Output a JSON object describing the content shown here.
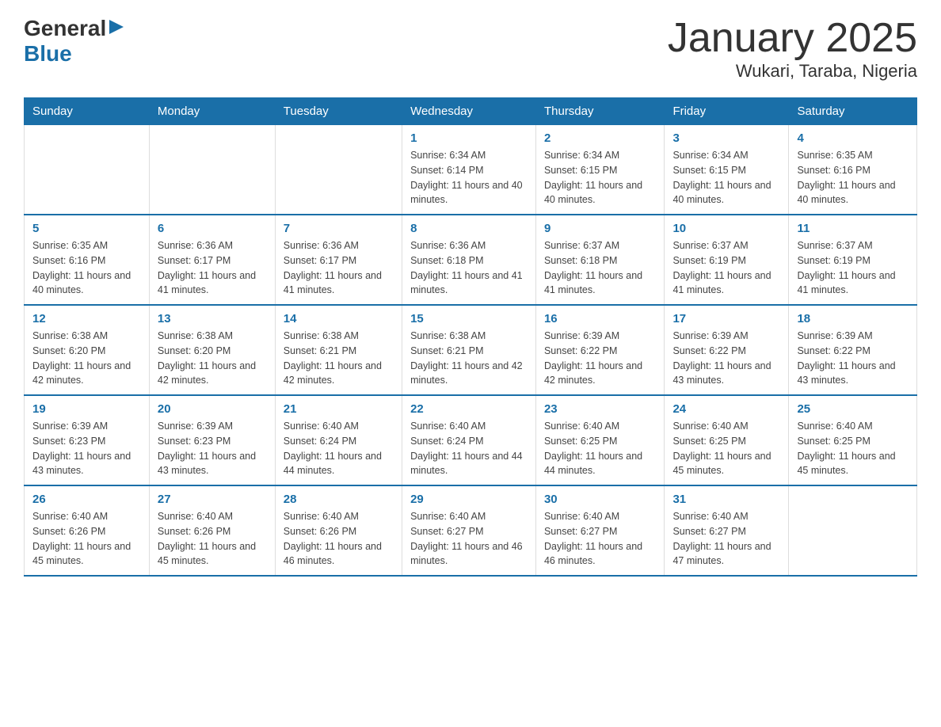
{
  "header": {
    "logo_general": "General",
    "logo_blue": "Blue",
    "month_title": "January 2025",
    "location": "Wukari, Taraba, Nigeria"
  },
  "days_of_week": [
    "Sunday",
    "Monday",
    "Tuesday",
    "Wednesday",
    "Thursday",
    "Friday",
    "Saturday"
  ],
  "weeks": [
    [
      {
        "day": "",
        "info": ""
      },
      {
        "day": "",
        "info": ""
      },
      {
        "day": "",
        "info": ""
      },
      {
        "day": "1",
        "info": "Sunrise: 6:34 AM\nSunset: 6:14 PM\nDaylight: 11 hours and 40 minutes."
      },
      {
        "day": "2",
        "info": "Sunrise: 6:34 AM\nSunset: 6:15 PM\nDaylight: 11 hours and 40 minutes."
      },
      {
        "day": "3",
        "info": "Sunrise: 6:34 AM\nSunset: 6:15 PM\nDaylight: 11 hours and 40 minutes."
      },
      {
        "day": "4",
        "info": "Sunrise: 6:35 AM\nSunset: 6:16 PM\nDaylight: 11 hours and 40 minutes."
      }
    ],
    [
      {
        "day": "5",
        "info": "Sunrise: 6:35 AM\nSunset: 6:16 PM\nDaylight: 11 hours and 40 minutes."
      },
      {
        "day": "6",
        "info": "Sunrise: 6:36 AM\nSunset: 6:17 PM\nDaylight: 11 hours and 41 minutes."
      },
      {
        "day": "7",
        "info": "Sunrise: 6:36 AM\nSunset: 6:17 PM\nDaylight: 11 hours and 41 minutes."
      },
      {
        "day": "8",
        "info": "Sunrise: 6:36 AM\nSunset: 6:18 PM\nDaylight: 11 hours and 41 minutes."
      },
      {
        "day": "9",
        "info": "Sunrise: 6:37 AM\nSunset: 6:18 PM\nDaylight: 11 hours and 41 minutes."
      },
      {
        "day": "10",
        "info": "Sunrise: 6:37 AM\nSunset: 6:19 PM\nDaylight: 11 hours and 41 minutes."
      },
      {
        "day": "11",
        "info": "Sunrise: 6:37 AM\nSunset: 6:19 PM\nDaylight: 11 hours and 41 minutes."
      }
    ],
    [
      {
        "day": "12",
        "info": "Sunrise: 6:38 AM\nSunset: 6:20 PM\nDaylight: 11 hours and 42 minutes."
      },
      {
        "day": "13",
        "info": "Sunrise: 6:38 AM\nSunset: 6:20 PM\nDaylight: 11 hours and 42 minutes."
      },
      {
        "day": "14",
        "info": "Sunrise: 6:38 AM\nSunset: 6:21 PM\nDaylight: 11 hours and 42 minutes."
      },
      {
        "day": "15",
        "info": "Sunrise: 6:38 AM\nSunset: 6:21 PM\nDaylight: 11 hours and 42 minutes."
      },
      {
        "day": "16",
        "info": "Sunrise: 6:39 AM\nSunset: 6:22 PM\nDaylight: 11 hours and 42 minutes."
      },
      {
        "day": "17",
        "info": "Sunrise: 6:39 AM\nSunset: 6:22 PM\nDaylight: 11 hours and 43 minutes."
      },
      {
        "day": "18",
        "info": "Sunrise: 6:39 AM\nSunset: 6:22 PM\nDaylight: 11 hours and 43 minutes."
      }
    ],
    [
      {
        "day": "19",
        "info": "Sunrise: 6:39 AM\nSunset: 6:23 PM\nDaylight: 11 hours and 43 minutes."
      },
      {
        "day": "20",
        "info": "Sunrise: 6:39 AM\nSunset: 6:23 PM\nDaylight: 11 hours and 43 minutes."
      },
      {
        "day": "21",
        "info": "Sunrise: 6:40 AM\nSunset: 6:24 PM\nDaylight: 11 hours and 44 minutes."
      },
      {
        "day": "22",
        "info": "Sunrise: 6:40 AM\nSunset: 6:24 PM\nDaylight: 11 hours and 44 minutes."
      },
      {
        "day": "23",
        "info": "Sunrise: 6:40 AM\nSunset: 6:25 PM\nDaylight: 11 hours and 44 minutes."
      },
      {
        "day": "24",
        "info": "Sunrise: 6:40 AM\nSunset: 6:25 PM\nDaylight: 11 hours and 45 minutes."
      },
      {
        "day": "25",
        "info": "Sunrise: 6:40 AM\nSunset: 6:25 PM\nDaylight: 11 hours and 45 minutes."
      }
    ],
    [
      {
        "day": "26",
        "info": "Sunrise: 6:40 AM\nSunset: 6:26 PM\nDaylight: 11 hours and 45 minutes."
      },
      {
        "day": "27",
        "info": "Sunrise: 6:40 AM\nSunset: 6:26 PM\nDaylight: 11 hours and 45 minutes."
      },
      {
        "day": "28",
        "info": "Sunrise: 6:40 AM\nSunset: 6:26 PM\nDaylight: 11 hours and 46 minutes."
      },
      {
        "day": "29",
        "info": "Sunrise: 6:40 AM\nSunset: 6:27 PM\nDaylight: 11 hours and 46 minutes."
      },
      {
        "day": "30",
        "info": "Sunrise: 6:40 AM\nSunset: 6:27 PM\nDaylight: 11 hours and 46 minutes."
      },
      {
        "day": "31",
        "info": "Sunrise: 6:40 AM\nSunset: 6:27 PM\nDaylight: 11 hours and 47 minutes."
      },
      {
        "day": "",
        "info": ""
      }
    ]
  ]
}
